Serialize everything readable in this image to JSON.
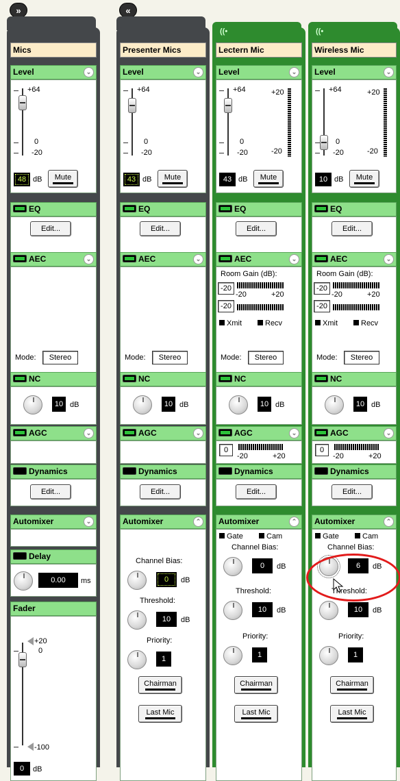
{
  "strips": [
    {
      "title": "Mics",
      "level": {
        "scale_top": "+64",
        "scale_zero": "0",
        "scale_bottom": "-20",
        "value": "48",
        "unit": "dB",
        "mute_label": "Mute",
        "slider_fraction": 0.85
      },
      "eq": {
        "label": "EQ",
        "edit_label": "Edit..."
      },
      "aec": {
        "label": "AEC",
        "mode_label": "Mode:",
        "mode_value": "Stereo"
      },
      "nc": {
        "label": "NC",
        "value": "10",
        "unit": "dB"
      },
      "agc": {
        "label": "AGC"
      },
      "dynamics": {
        "label": "Dynamics",
        "edit_label": "Edit..."
      },
      "automixer": {
        "label": "Automixer"
      },
      "delay": {
        "label": "Delay",
        "value": "0.00",
        "unit": "ms"
      },
      "fader": {
        "label": "Fader",
        "scale_top": "+20",
        "scale_zero": "0",
        "scale_bottom": "-100",
        "value": "0",
        "unit": "dB"
      }
    },
    {
      "title": "Presenter Mics",
      "level": {
        "scale_top": "+64",
        "scale_zero": "0",
        "scale_bottom": "-20",
        "value": "43",
        "unit": "dB",
        "mute_label": "Mute"
      },
      "eq": {
        "label": "EQ",
        "edit_label": "Edit..."
      },
      "aec": {
        "label": "AEC",
        "mode_label": "Mode:",
        "mode_value": "Stereo"
      },
      "nc": {
        "label": "NC",
        "value": "10",
        "unit": "dB"
      },
      "agc": {
        "label": "AGC"
      },
      "dynamics": {
        "label": "Dynamics",
        "edit_label": "Edit..."
      },
      "automixer": {
        "label": "Automixer",
        "bias_label": "Channel Bias:",
        "bias_value": "0",
        "threshold_label": "Threshold:",
        "threshold_value": "10",
        "priority_label": "Priority:",
        "priority_value": "1",
        "chairman_label": "Chairman",
        "lastmic_label": "Last Mic",
        "unit": "dB"
      }
    },
    {
      "title": "Lectern Mic",
      "level": {
        "scale_top": "+64",
        "scale_zero": "0",
        "scale_bottom": "-20",
        "meter_top": "+20",
        "meter_bottom": "-20",
        "value": "43",
        "unit": "dB",
        "mute_label": "Mute"
      },
      "eq": {
        "label": "EQ",
        "edit_label": "Edit..."
      },
      "aec": {
        "label": "AEC",
        "room_gain_label": "Room Gain (dB):",
        "gain1": "-20",
        "gain2": "-20",
        "range_low": "-20",
        "range_high": "+20",
        "xmit_label": "Xmit",
        "recv_label": "Recv",
        "mode_label": "Mode:",
        "mode_value": "Stereo"
      },
      "nc": {
        "label": "NC",
        "value": "10",
        "unit": "dB"
      },
      "agc": {
        "label": "AGC",
        "value": "0",
        "range_low": "-20",
        "range_high": "+20"
      },
      "dynamics": {
        "label": "Dynamics",
        "edit_label": "Edit..."
      },
      "automixer": {
        "label": "Automixer",
        "gate_label": "Gate",
        "cam_label": "Cam",
        "bias_label": "Channel Bias:",
        "bias_value": "0",
        "threshold_label": "Threshold:",
        "threshold_value": "10",
        "priority_label": "Priority:",
        "priority_value": "1",
        "chairman_label": "Chairman",
        "lastmic_label": "Last Mic",
        "unit": "dB"
      }
    },
    {
      "title": "Wireless Mic",
      "level": {
        "scale_top": "+64",
        "scale_zero": "0",
        "scale_bottom": "-20",
        "meter_top": "+20",
        "meter_bottom": "-20",
        "value": "10",
        "unit": "dB",
        "mute_label": "Mute"
      },
      "eq": {
        "label": "EQ",
        "edit_label": "Edit..."
      },
      "aec": {
        "label": "AEC",
        "room_gain_label": "Room Gain (dB):",
        "gain1": "-20",
        "gain2": "-20",
        "range_low": "-20",
        "range_high": "+20",
        "xmit_label": "Xmit",
        "recv_label": "Recv",
        "mode_label": "Mode:",
        "mode_value": "Stereo"
      },
      "nc": {
        "label": "NC",
        "value": "10",
        "unit": "dB"
      },
      "agc": {
        "label": "AGC",
        "value": "0",
        "range_low": "-20",
        "range_high": "+20"
      },
      "dynamics": {
        "label": "Dynamics",
        "edit_label": "Edit..."
      },
      "automixer": {
        "label": "Automixer",
        "gate_label": "Gate",
        "cam_label": "Cam",
        "bias_label": "Channel Bias:",
        "bias_value": "6",
        "threshold_label": "Threshold:",
        "threshold_value": "10",
        "priority_label": "Priority:",
        "priority_value": "1",
        "chairman_label": "Chairman",
        "lastmic_label": "Last Mic",
        "unit": "dB"
      }
    }
  ],
  "colors": {
    "header_green": "#8ee08a",
    "strip_green": "#2e8b2e",
    "strip_gray": "#44474a",
    "title_bg": "#fcecc8",
    "highlight_red": "#e21b1b"
  },
  "icons": {
    "collapse": "double-chevron-right-icon",
    "section_toggle": "chevron-down-icon",
    "wireless": "wireless-icon"
  }
}
